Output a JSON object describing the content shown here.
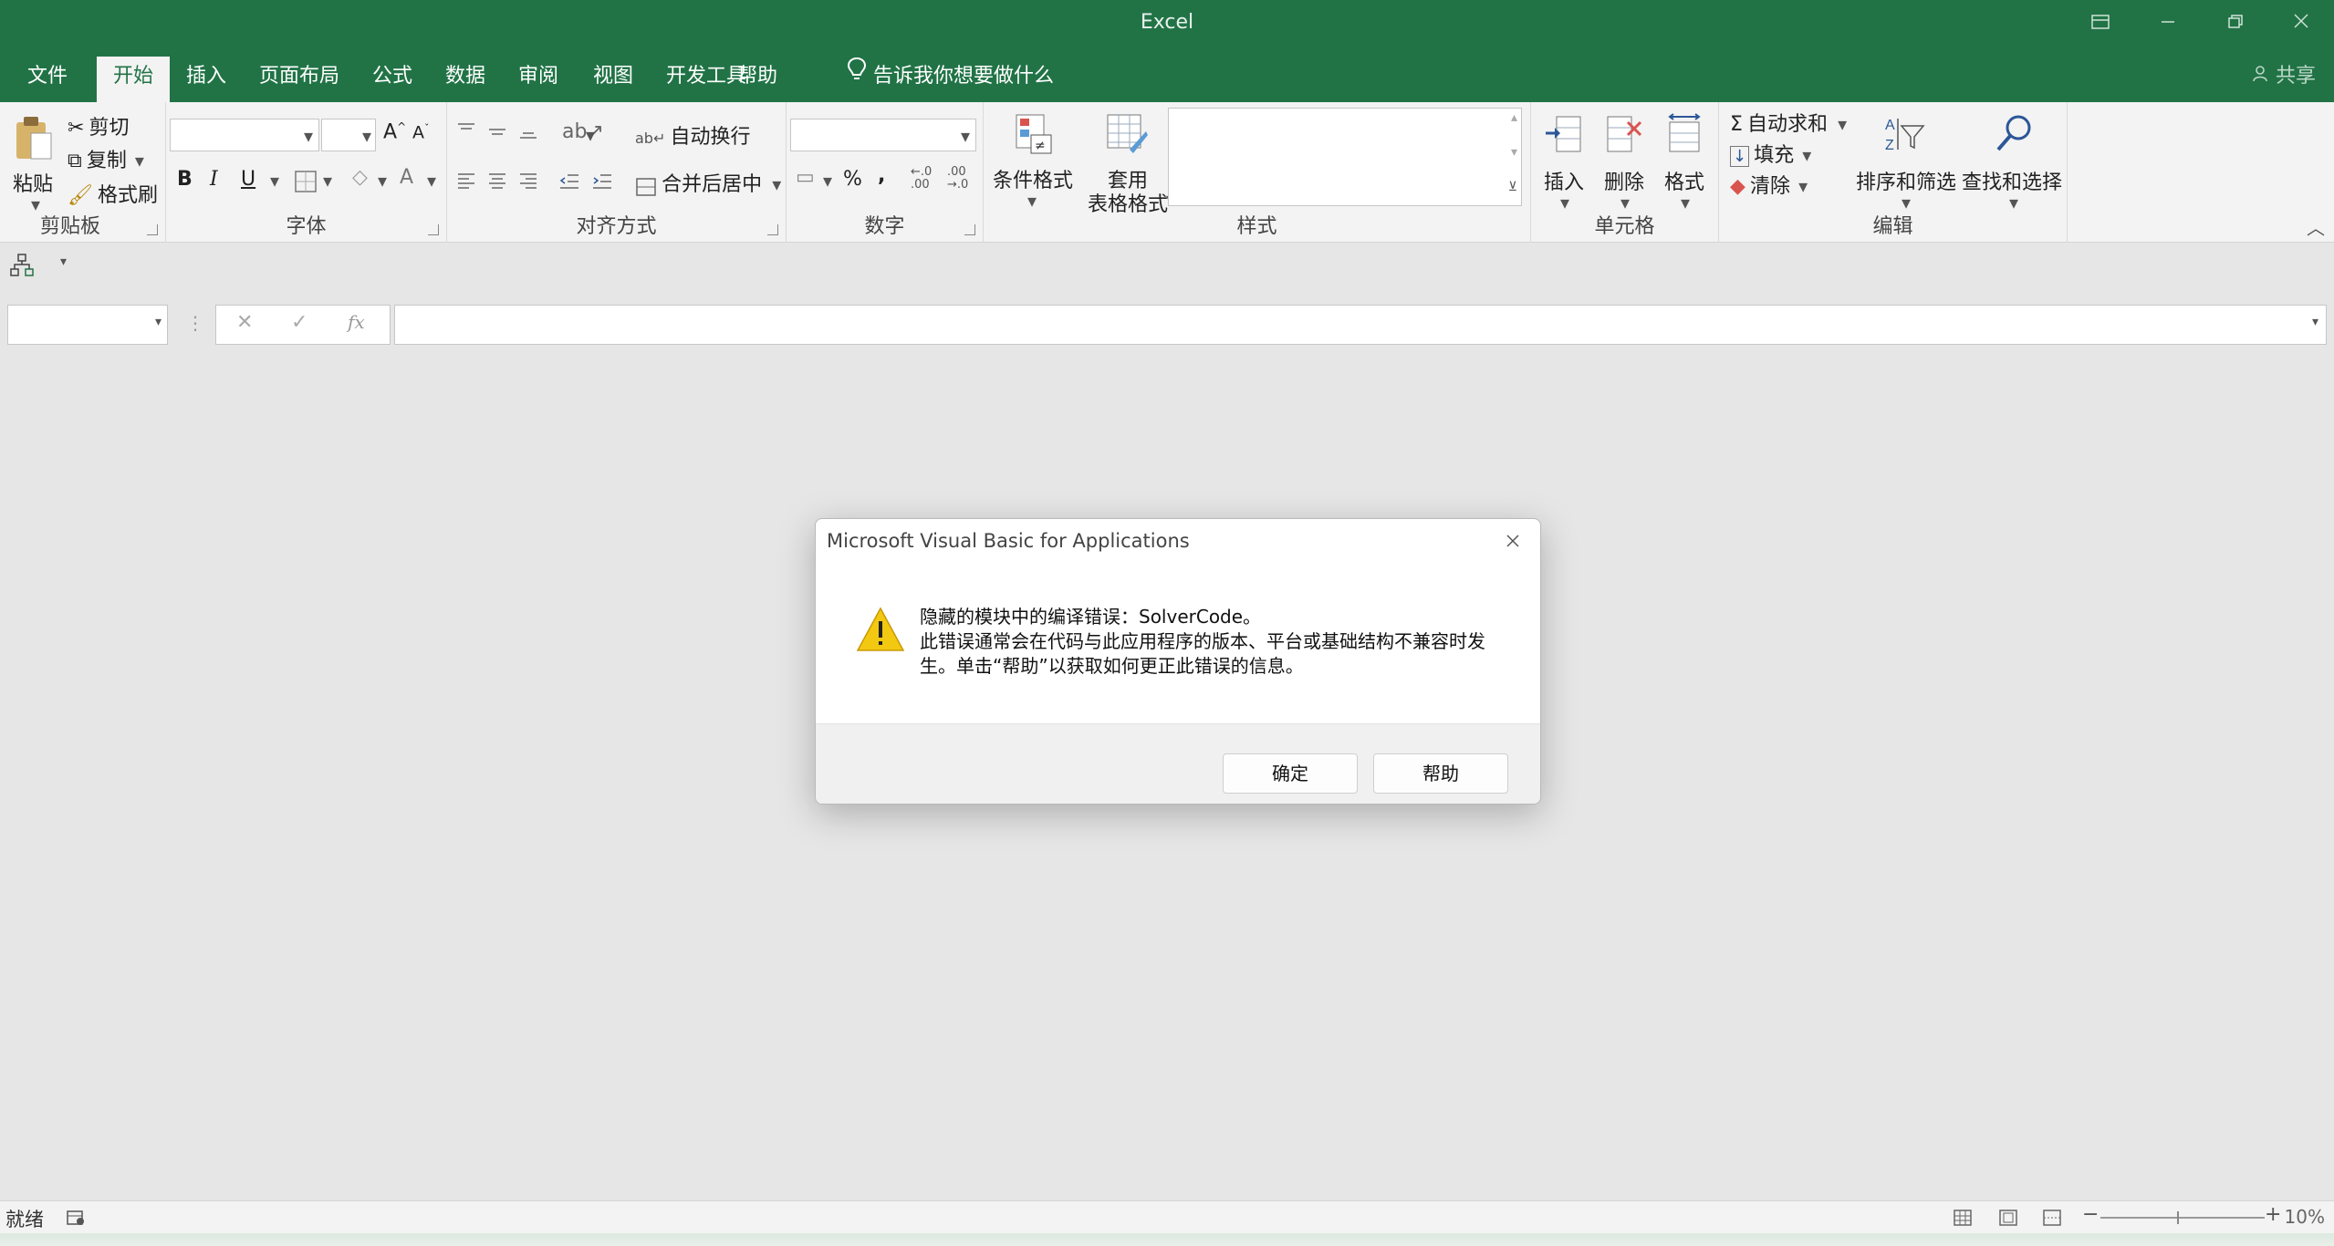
{
  "window": {
    "title": "Excel"
  },
  "tabs": [
    {
      "label": "文件"
    },
    {
      "label": "开始"
    },
    {
      "label": "插入"
    },
    {
      "label": "页面布局"
    },
    {
      "label": "公式"
    },
    {
      "label": "数据"
    },
    {
      "label": "审阅"
    },
    {
      "label": "视图"
    },
    {
      "label": "开发工具"
    },
    {
      "label": "帮助"
    }
  ],
  "tell_me": "告诉我你想要做什么",
  "share": "共享",
  "ribbon": {
    "clipboard": {
      "paste": "粘贴",
      "cut": "剪切",
      "copy": "复制",
      "format_painter": "格式刷",
      "label": "剪贴板"
    },
    "font": {
      "label": "字体",
      "bold": "B",
      "italic": "I",
      "underline": "U"
    },
    "alignment": {
      "wrap_text": "自动换行",
      "merge_center": "合并后居中",
      "label": "对齐方式"
    },
    "number": {
      "percent": "%",
      "comma": ",",
      "label": "数字"
    },
    "styles": {
      "conditional": "条件格式",
      "table_line1": "套用",
      "table_line2": "表格格式",
      "label": "样式"
    },
    "cells": {
      "insert": "插入",
      "delete": "删除",
      "format": "格式",
      "label": "单元格"
    },
    "editing": {
      "autosum": "自动求和",
      "fill": "填充",
      "clear": "清除",
      "sort_filter": "排序和筛选",
      "find_select": "查找和选择",
      "label": "编辑"
    }
  },
  "formula_bar": {
    "name_box": "",
    "formula": ""
  },
  "dialog": {
    "title": "Microsoft Visual Basic for Applications",
    "line1": "隐藏的模块中的编译错误：SolverCode。",
    "line2": "此错误通常会在代码与此应用程序的版本、平台或基础结构不兼容时发",
    "line3": "生。单击“帮助”以获取如何更正此错误的信息。",
    "ok": "确定",
    "help": "帮助"
  },
  "status": {
    "ready": "就绪",
    "zoom": "10%"
  },
  "colors": {
    "accent": "#217346",
    "ribbon_bg": "#f3f3f3",
    "warning": "#f2c811"
  }
}
